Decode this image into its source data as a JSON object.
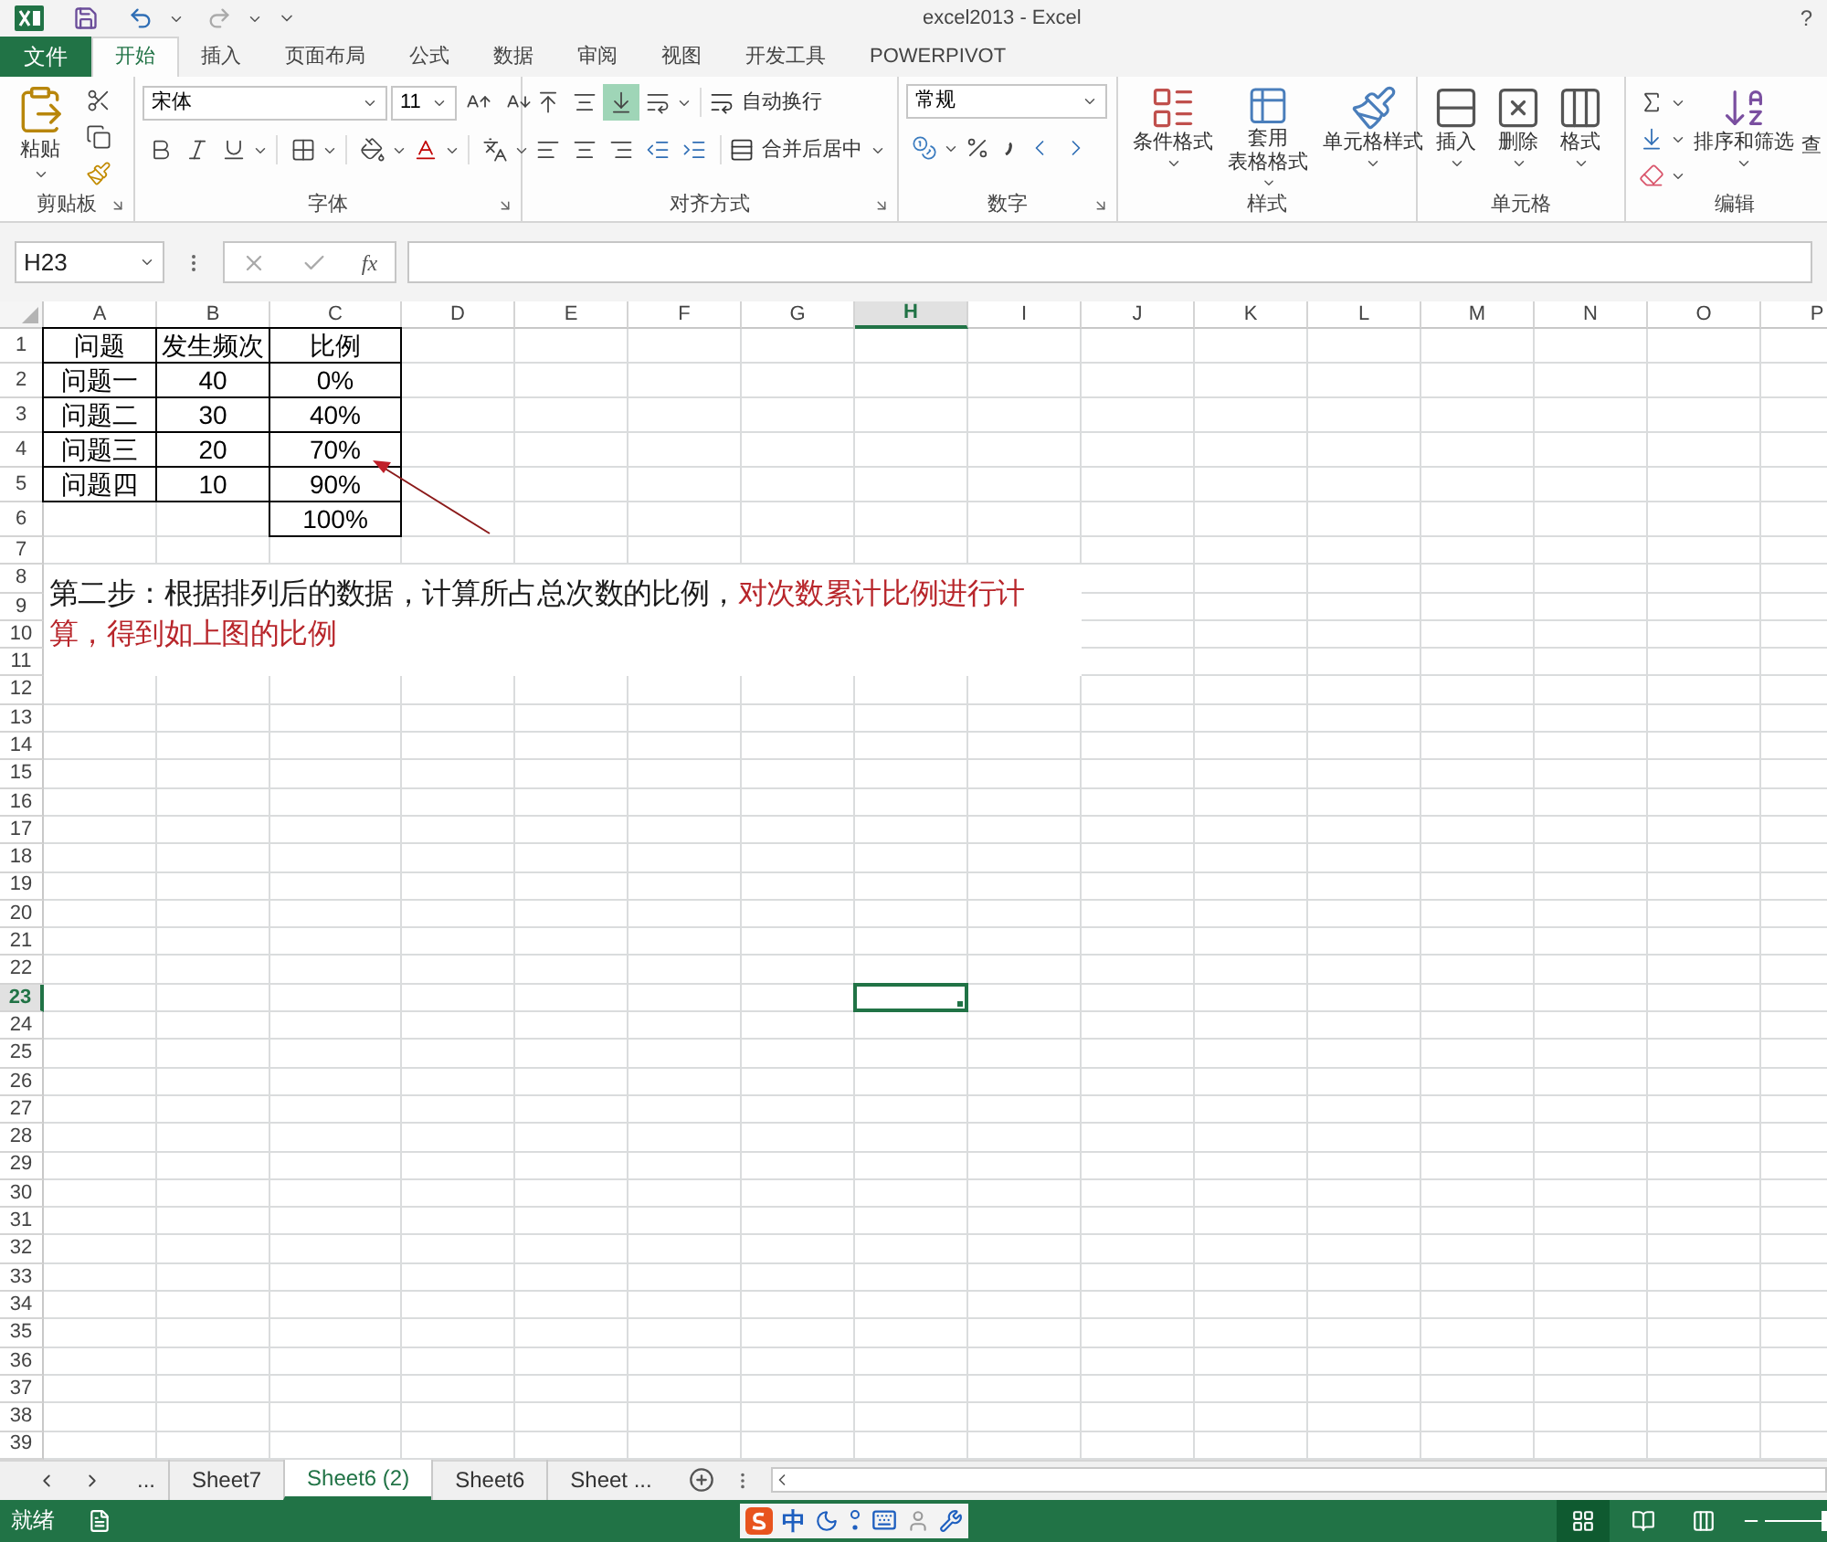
{
  "window": {
    "title": "excel2013 - Excel",
    "help": "?"
  },
  "ribbon_tabs": [
    {
      "label": "文件",
      "kind": "file",
      "selected": false
    },
    {
      "label": "开始",
      "kind": "tab",
      "selected": true
    },
    {
      "label": "插入",
      "kind": "tab",
      "selected": false
    },
    {
      "label": "页面布局",
      "kind": "tab",
      "selected": false
    },
    {
      "label": "公式",
      "kind": "tab",
      "selected": false
    },
    {
      "label": "数据",
      "kind": "tab",
      "selected": false
    },
    {
      "label": "审阅",
      "kind": "tab",
      "selected": false
    },
    {
      "label": "视图",
      "kind": "tab",
      "selected": false
    },
    {
      "label": "开发工具",
      "kind": "tab",
      "selected": false
    },
    {
      "label": "POWERPIVOT",
      "kind": "tab",
      "selected": false
    }
  ],
  "ribbon": {
    "clipboard": {
      "label": "剪贴板",
      "launcher": true,
      "paste": "粘贴"
    },
    "font": {
      "label": "字体",
      "launcher": true,
      "font_name": "宋体",
      "font_size": "11"
    },
    "alignment": {
      "label": "对齐方式",
      "launcher": true,
      "wrap": "自动换行",
      "merge": "合并后居中",
      "bottom_align_selected": true
    },
    "number": {
      "label": "数字",
      "launcher": true,
      "format": "常规"
    },
    "styles": {
      "label": "样式",
      "launcher": false,
      "buttons": [
        {
          "lines": [
            "条件格式"
          ]
        },
        {
          "lines": [
            "套用",
            "表格格式"
          ]
        },
        {
          "lines": [
            "单元格样式"
          ]
        }
      ]
    },
    "cells": {
      "label": "单元格",
      "launcher": false,
      "buttons": [
        {
          "lines": [
            "插入"
          ]
        },
        {
          "lines": [
            "删除"
          ]
        },
        {
          "lines": [
            "格式"
          ]
        }
      ]
    },
    "editing": {
      "label": "编辑",
      "launcher": false,
      "sort": "排序和筛选",
      "find": "查"
    }
  },
  "formula_bar": {
    "name_box": "H23",
    "fx": "fx"
  },
  "columns": [
    {
      "label": "A",
      "selected": false
    },
    {
      "label": "B",
      "selected": false
    },
    {
      "label": "C",
      "selected": false
    },
    {
      "label": "D",
      "selected": false
    },
    {
      "label": "E",
      "selected": false
    },
    {
      "label": "F",
      "selected": false
    },
    {
      "label": "G",
      "selected": false
    },
    {
      "label": "H",
      "selected": true
    },
    {
      "label": "I",
      "selected": false
    },
    {
      "label": "J",
      "selected": false
    },
    {
      "label": "K",
      "selected": false
    },
    {
      "label": "L",
      "selected": false
    },
    {
      "label": "M",
      "selected": false
    },
    {
      "label": "N",
      "selected": false
    },
    {
      "label": "O",
      "selected": false
    },
    {
      "label": "P",
      "selected": false
    }
  ],
  "rows": [
    {
      "label": "1",
      "selected": false
    },
    {
      "label": "2",
      "selected": false
    },
    {
      "label": "3",
      "selected": false
    },
    {
      "label": "4",
      "selected": false
    },
    {
      "label": "5",
      "selected": false
    },
    {
      "label": "6",
      "selected": false
    },
    {
      "label": "7",
      "selected": false
    },
    {
      "label": "8",
      "selected": false
    },
    {
      "label": "9",
      "selected": false
    },
    {
      "label": "10",
      "selected": false
    },
    {
      "label": "11",
      "selected": false
    },
    {
      "label": "12",
      "selected": false
    },
    {
      "label": "13",
      "selected": false
    },
    {
      "label": "14",
      "selected": false
    },
    {
      "label": "15",
      "selected": false
    },
    {
      "label": "16",
      "selected": false
    },
    {
      "label": "17",
      "selected": false
    },
    {
      "label": "18",
      "selected": false
    },
    {
      "label": "19",
      "selected": false
    },
    {
      "label": "20",
      "selected": false
    },
    {
      "label": "21",
      "selected": false
    },
    {
      "label": "22",
      "selected": false
    },
    {
      "label": "23",
      "selected": true
    },
    {
      "label": "24",
      "selected": false
    },
    {
      "label": "25",
      "selected": false
    },
    {
      "label": "26",
      "selected": false
    },
    {
      "label": "27",
      "selected": false
    },
    {
      "label": "28",
      "selected": false
    },
    {
      "label": "29",
      "selected": false
    },
    {
      "label": "30",
      "selected": false
    },
    {
      "label": "31",
      "selected": false
    },
    {
      "label": "32",
      "selected": false
    },
    {
      "label": "33",
      "selected": false
    },
    {
      "label": "34",
      "selected": false
    },
    {
      "label": "35",
      "selected": false
    },
    {
      "label": "36",
      "selected": false
    },
    {
      "label": "37",
      "selected": false
    },
    {
      "label": "38",
      "selected": false
    },
    {
      "label": "39",
      "selected": false
    }
  ],
  "table_rows": [
    {
      "a": "问题",
      "b": "发生频次",
      "c": "比例"
    },
    {
      "a": "问题一",
      "b": "40",
      "c": "0%"
    },
    {
      "a": "问题二",
      "b": "30",
      "c": "40%"
    },
    {
      "a": "问题三",
      "b": "20",
      "c": "70%"
    },
    {
      "a": "问题四",
      "b": "10",
      "c": "90%"
    },
    {
      "c": "100%"
    }
  ],
  "annotation": {
    "segments": [
      {
        "text": "第二步：根据排列后的数据，计算所占总次数的比例，",
        "color": "#1a1a1a"
      },
      {
        "text": "对次数累计比例进行计算，得到如上图的比例",
        "color": "#b8262b"
      }
    ]
  },
  "sheet_tabs": {
    "more": "...",
    "tabs": [
      {
        "label": "Sheet7",
        "selected": false
      },
      {
        "label": "Sheet6 (2)",
        "selected": true
      },
      {
        "label": "Sheet6",
        "selected": false
      },
      {
        "label": "Sheet ...",
        "selected": false
      }
    ]
  },
  "status_bar": {
    "status": "就绪",
    "ime": "中",
    "zoom_slider": {
      "level": 0.5
    }
  }
}
